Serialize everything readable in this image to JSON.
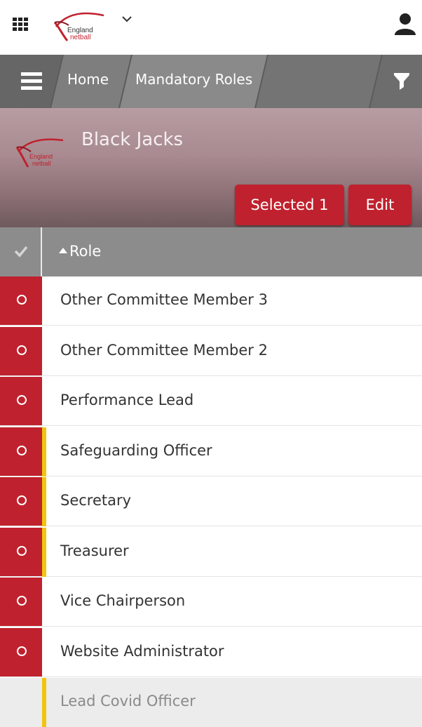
{
  "header": {
    "logo_text_line1": "England",
    "logo_text_line2": "netball"
  },
  "nav": {
    "breadcrumbs": [
      "Home",
      "Mandatory Roles"
    ]
  },
  "team": {
    "name": "Black Jacks",
    "selected_label": "Selected 1",
    "edit_label": "Edit"
  },
  "table": {
    "column": "Role",
    "sort": "ascending",
    "rows": [
      {
        "label": "Other Committee Member 3",
        "status": "unassigned",
        "flag": false
      },
      {
        "label": "Other Committee Member 2",
        "status": "unassigned",
        "flag": false
      },
      {
        "label": "Performance Lead",
        "status": "unassigned",
        "flag": false
      },
      {
        "label": "Safeguarding Officer",
        "status": "unassigned",
        "flag": true
      },
      {
        "label": "Secretary",
        "status": "unassigned",
        "flag": true
      },
      {
        "label": "Treasurer",
        "status": "unassigned",
        "flag": true
      },
      {
        "label": "Vice Chairperson",
        "status": "unassigned",
        "flag": false
      },
      {
        "label": "Website Administrator",
        "status": "unassigned",
        "flag": false
      },
      {
        "label": "Lead Covid Officer",
        "status": "inactive",
        "flag": true
      }
    ]
  },
  "colors": {
    "accent": "#c0212e",
    "flag": "#f1c40f",
    "navbar": "#6d6d6d",
    "table_header": "#8c8c8c"
  },
  "icons": {
    "apps": "grid-icon",
    "menu": "hamburger-icon",
    "filter": "filter-icon",
    "user": "user-icon",
    "dropdown": "chevron-down-icon"
  }
}
